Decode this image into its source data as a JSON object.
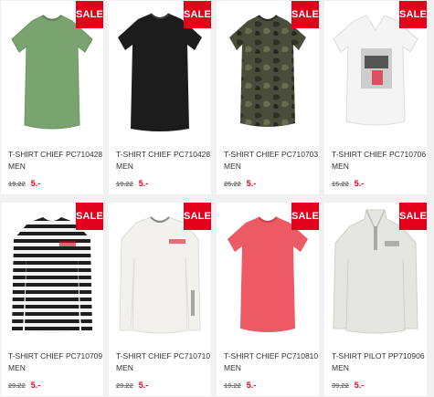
{
  "badge": "SALE",
  "products": [
    {
      "title": "T-SHIRT CHIEF PC710428",
      "subtitle": "MEN",
      "old_price": "19.22",
      "new_price": "5.-",
      "color": "#79a36f"
    },
    {
      "title": "T-SHIRT CHIEF PC710428",
      "subtitle": "MEN",
      "old_price": "19.22",
      "new_price": "5.-",
      "color": "#1c1c1c"
    },
    {
      "title": "T-SHIRT CHIEF PC710703",
      "subtitle": "MEN",
      "old_price": "25.22",
      "new_price": "5.-",
      "color": "#3e4232"
    },
    {
      "title": "T-SHIRT CHIEF PC710706",
      "subtitle": "MEN",
      "old_price": "15.22",
      "new_price": "5.-",
      "color": "#f4f4f4"
    },
    {
      "title": "T-SHIRT CHIEF PC710709",
      "subtitle": "MEN",
      "old_price": "29.22",
      "new_price": "5.-",
      "color": "#1e1e1e"
    },
    {
      "title": "T-SHIRT CHIEF PC710710",
      "subtitle": "MEN",
      "old_price": "29.22",
      "new_price": "5.-",
      "color": "#f2f1ee"
    },
    {
      "title": "T-SHIRT CHIEF PC710810",
      "subtitle": "MEN",
      "old_price": "19.22",
      "new_price": "5.-",
      "color": "#ec5a66"
    },
    {
      "title": "T-SHIRT PILOT PP710906",
      "subtitle": "MEN",
      "old_price": "39.22",
      "new_price": "5.-",
      "color": "#e6e6e1"
    }
  ]
}
